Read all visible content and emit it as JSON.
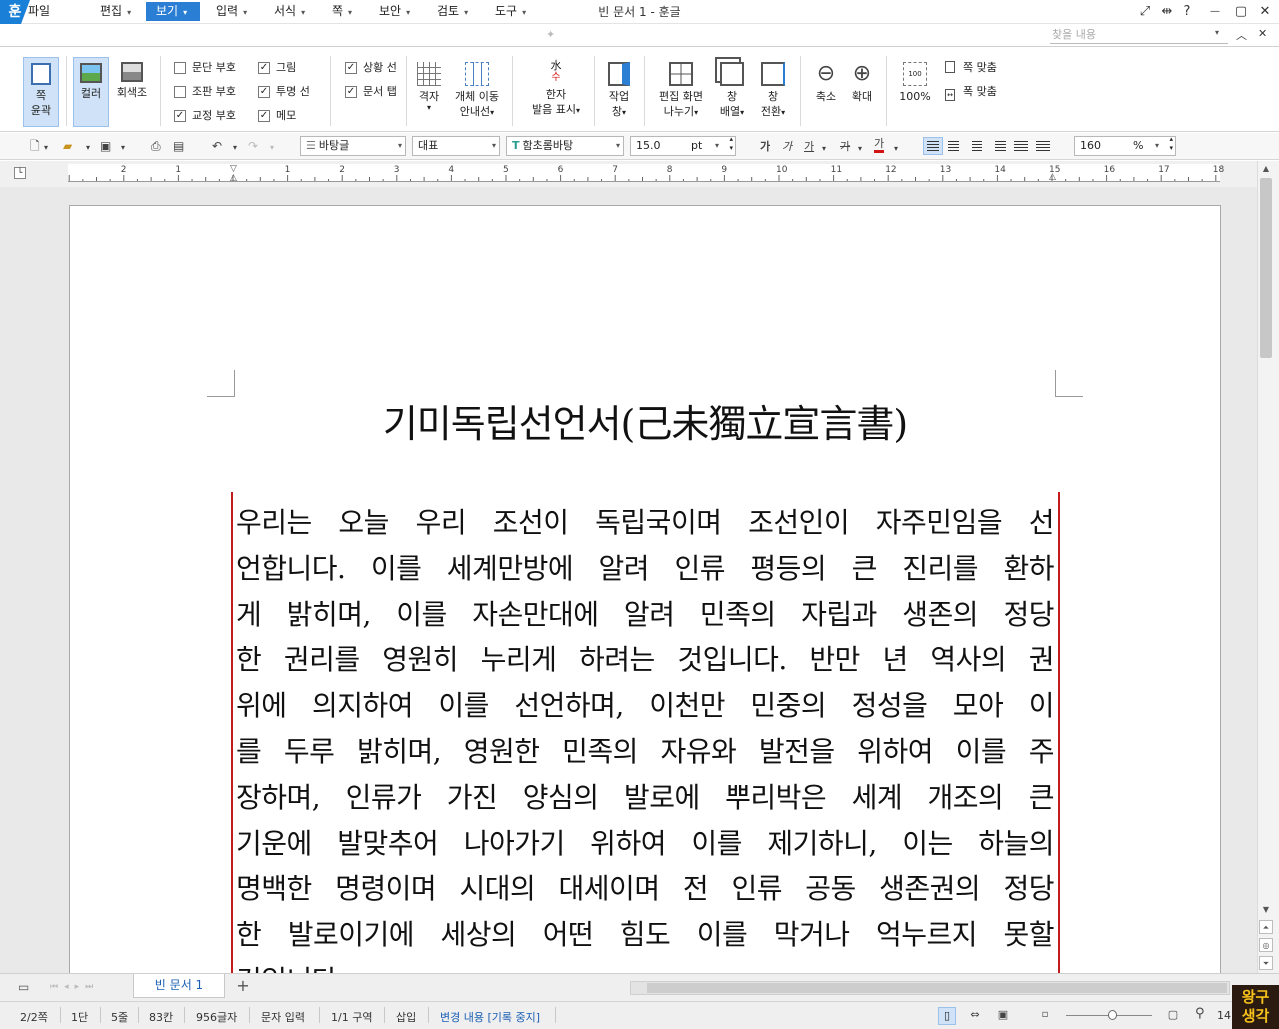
{
  "window": {
    "title": "빈 문서 1 - 훈글",
    "logo_char": "훈",
    "controls": [
      "fullscreen-icon",
      "pin-icon",
      "help-icon",
      "minimize-icon",
      "restore-icon",
      "close-icon"
    ],
    "control_glyphs": [
      "⤢",
      "⇹",
      "?",
      "—",
      "▢",
      "✕"
    ]
  },
  "menubar": {
    "items": [
      {
        "label": "파일",
        "arrow": false,
        "active": false
      },
      {
        "label": "편집",
        "arrow": true,
        "active": false
      },
      {
        "label": "보기",
        "arrow": true,
        "active": true
      },
      {
        "label": "입력",
        "arrow": true,
        "active": false
      },
      {
        "label": "서식",
        "arrow": true,
        "active": false
      },
      {
        "label": "쪽",
        "arrow": true,
        "active": false
      },
      {
        "label": "보안",
        "arrow": true,
        "active": false
      },
      {
        "label": "검토",
        "arrow": true,
        "active": false
      },
      {
        "label": "도구",
        "arrow": true,
        "active": false
      }
    ],
    "search_placeholder": "찾을 내용"
  },
  "ribbon": {
    "page_outline": {
      "line1": "쪽",
      "line2": "윤곽"
    },
    "color": "컬러",
    "grayscale": "회색조",
    "checks_col1": [
      {
        "label": "문단 부호",
        "checked": false
      },
      {
        "label": "조판 부호",
        "checked": false
      },
      {
        "label": "교정 부호",
        "checked": true
      }
    ],
    "checks_col2": [
      {
        "label": "그림",
        "checked": true
      },
      {
        "label": "투명 선",
        "checked": true
      },
      {
        "label": "메모",
        "checked": true
      }
    ],
    "checks_col3": [
      {
        "label": "상황 선",
        "checked": true
      },
      {
        "label": "문서 탭",
        "checked": true
      }
    ],
    "grid": "격자",
    "object_move": {
      "line1": "개체 이동",
      "line2": "안내선"
    },
    "hanja": {
      "line1": "한자",
      "line2": "발음 표시"
    },
    "hanja_icon_top": "水",
    "hanja_icon_bottom": "수",
    "task_pane": {
      "line1": "작업",
      "line2": "창"
    },
    "split": {
      "line1": "편집 화면",
      "line2": "나누기"
    },
    "arrange": {
      "line1": "창",
      "line2": "배열"
    },
    "switch": {
      "line1": "창",
      "line2": "전환"
    },
    "zoom_out": "축소",
    "zoom_in": "확대",
    "zoom_100": "100%",
    "fit_page": "쪽 맞춤",
    "fit_width": "폭 맞춤"
  },
  "toolbar": {
    "style": "바탕글",
    "lang": "대표",
    "font": "함초롬바탕",
    "size": "15.0",
    "unit": "pt",
    "zoom": "160",
    "zoom_unit": "%",
    "text_color": "#d21414"
  },
  "ruler": {
    "numbers": [
      "2",
      "1",
      "1",
      "2",
      "3",
      "4",
      "5",
      "6",
      "7",
      "8",
      "9",
      "10",
      "11",
      "12",
      "13",
      "14",
      "15",
      "16",
      "17",
      "18"
    ]
  },
  "document": {
    "title": "기미독립선언서(己未獨立宣言書)",
    "lines": [
      "우리는 오늘 우리 조선이 독립국이며 조선인이 자주민임을 선",
      "언합니다. 이를 세계만방에 알려 인류 평등의 큰 진리를 환하",
      "게 밝히며, 이를 자손만대에 알려 민족의 자립과 생존의 정당",
      "한 권리를 영원히 누리게 하려는 것입니다. 반만 년 역사의 권",
      "위에 의지하여 이를 선언하며, 이천만 민중의 정성을 모아 이",
      "를 두루 밝히며, 영원한 민족의 자유와 발전을 위하여 이를 주",
      "장하며, 인류가 가진 양심의 발로에 뿌리박은 세계 개조의 큰",
      "기운에 발맞추어 나아가기 위하여 이를 제기하니, 이는 하늘의",
      "명백한 명령이며 시대의 대세이며 전 인류 공동 생존권의 정당",
      "한 발로이기에 세상의 어떤 힘도 이를 막거나 억누르지 못할",
      "것입니다."
    ]
  },
  "tabs": {
    "doc_tab": "빈 문서 1",
    "add": "+"
  },
  "status": {
    "page": "2/2쪽",
    "column": "1단",
    "line": "5줄",
    "col": "83칸",
    "chars": "956글자",
    "mode": "문자 입력",
    "section": "1/1 구역",
    "insert": "삽입",
    "track": "변경 내용 [기록 중지]",
    "zoom_partial": "14"
  },
  "watermark": {
    "line1": "왕구",
    "line2": "생각"
  }
}
